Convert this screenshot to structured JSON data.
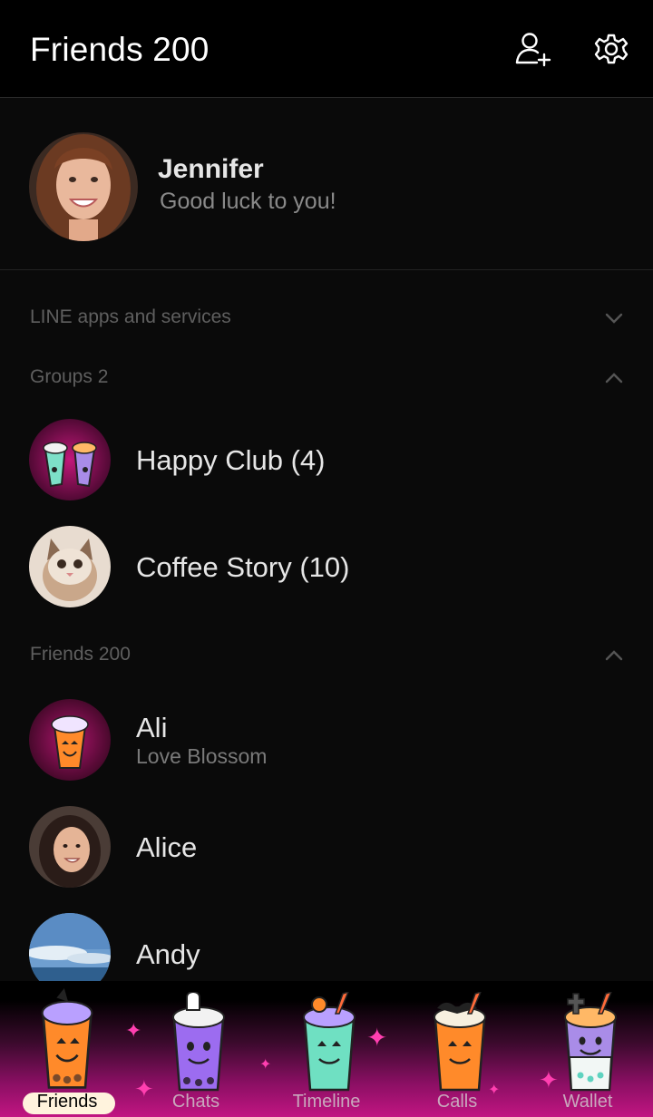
{
  "header": {
    "title": "Friends 200",
    "add_friend_icon": "add-friend-icon",
    "settings_icon": "gear-icon"
  },
  "profile": {
    "name": "Jennifer",
    "status": "Good luck to you!"
  },
  "sections": {
    "line_apps": {
      "label": "LINE apps and services",
      "state": "collapsed"
    },
    "groups": {
      "label": "Groups 2",
      "state": "expanded"
    },
    "friends": {
      "label": "Friends 200",
      "state": "expanded"
    }
  },
  "groups": [
    {
      "name": "Happy Club (4)"
    },
    {
      "name": "Coffee Story (10)"
    }
  ],
  "friends": [
    {
      "name": "Ali",
      "status": "Love Blossom"
    },
    {
      "name": "Alice",
      "status": ""
    },
    {
      "name": "Andy",
      "status": ""
    }
  ],
  "tabs": [
    {
      "label": "Friends",
      "active": true
    },
    {
      "label": "Chats",
      "active": false
    },
    {
      "label": "Timeline",
      "active": false
    },
    {
      "label": "Calls",
      "active": false
    },
    {
      "label": "Wallet",
      "active": false
    }
  ],
  "colors": {
    "background": "#0a0a0a",
    "header": "#000000",
    "tab_accent": "#c21582",
    "muted_text": "#5f5f5f"
  }
}
